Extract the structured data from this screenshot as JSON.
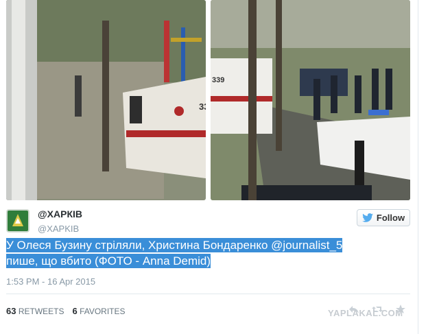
{
  "user": {
    "display_name": "@ХАРКІВ",
    "screen_name": "@XAPKIB"
  },
  "follow_label": "Follow",
  "tweet": {
    "line1": "У Олеся Бузину стріляли, Христина Бондаренко @journalist_5",
    "line2": "пише, що вбито (ФОТО - Anna Demid)"
  },
  "timestamp": "1:53 PM - 16 Apr 2015",
  "stats": {
    "retweets_count": "63",
    "retweets_label": "RETWEETS",
    "favorites_count": "6",
    "favorites_label": "FAVORITES"
  },
  "photo_left_badge": "33",
  "photo_right_badge": "339",
  "watermark": "YAPLAKAL.COM",
  "colors": {
    "highlight": "#3a8ed8",
    "twitter_blue": "#55acee",
    "avatar_green": "#2f7d3a"
  }
}
